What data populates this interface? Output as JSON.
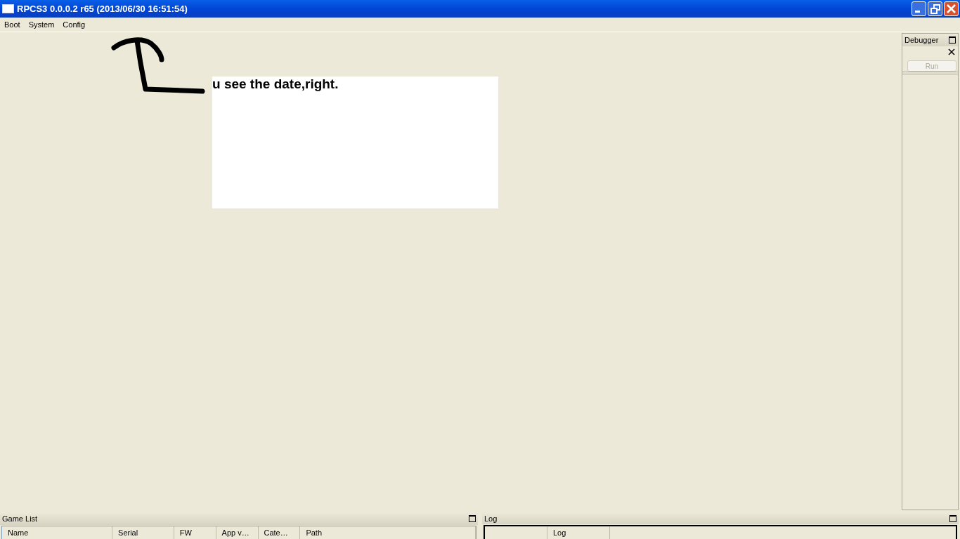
{
  "window": {
    "title": "RPCS3 0.0.0.2 r65 (2013/06/30 16:51:54)"
  },
  "menu": [
    {
      "label": "Boot"
    },
    {
      "label": "System"
    },
    {
      "label": "Config"
    }
  ],
  "note": {
    "text": "u see the date,right."
  },
  "debugger": {
    "title": "Debugger",
    "button": "Run"
  },
  "game_list": {
    "title": "Game List",
    "columns": [
      "Name",
      "Serial",
      "FW",
      "App v…",
      "Cate…",
      "Path"
    ]
  },
  "log": {
    "title": "Log",
    "columns": [
      "Log"
    ]
  }
}
